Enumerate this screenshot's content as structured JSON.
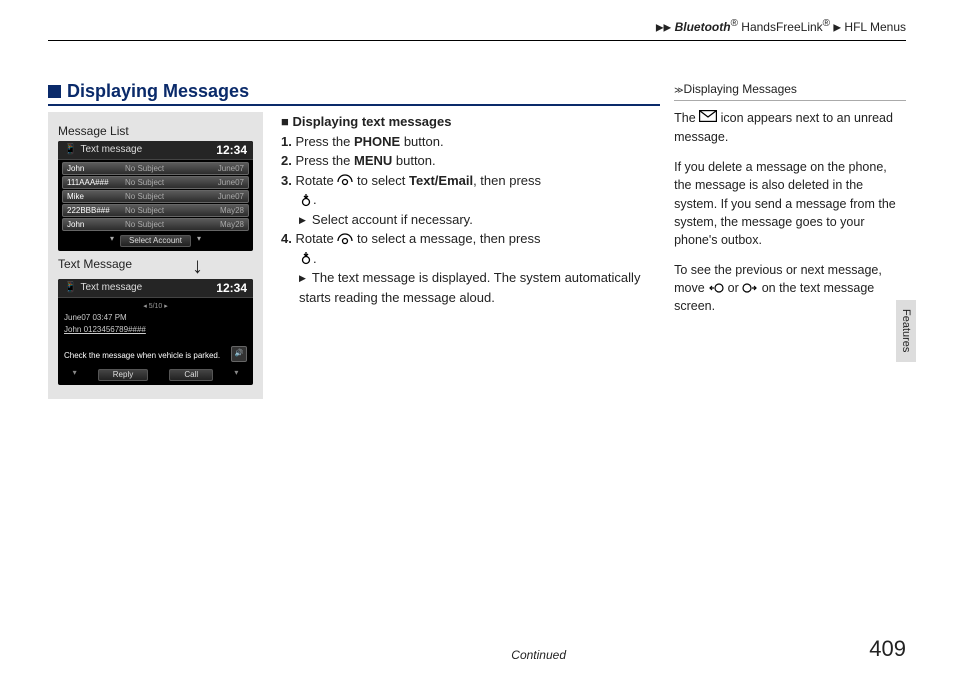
{
  "breadcrumb": {
    "bt": "Bluetooth",
    "reg": "®",
    "hfl": " HandsFreeLink",
    "sep": "▶",
    "tail": "HFL Menus"
  },
  "section": {
    "title": "Displaying Messages"
  },
  "figure": {
    "label1": "Message List",
    "label2": "Text Message",
    "arrow": "↓",
    "ss1": {
      "title": "Text message",
      "clock": "12:34",
      "rows": [
        {
          "sender": "John",
          "subj": "No Subject",
          "date": "June07"
        },
        {
          "sender": "111AAA###",
          "subj": "No Subject",
          "date": "June07"
        },
        {
          "sender": "Mike",
          "subj": "No Subject",
          "date": "June07"
        },
        {
          "sender": "222BBB###",
          "subj": "No Subject",
          "date": "May28"
        },
        {
          "sender": "John",
          "subj": "No Subject",
          "date": "May28"
        }
      ],
      "footer": "Select Account"
    },
    "ss2": {
      "title": "Text message",
      "clock": "12:34",
      "counter": "5/10",
      "meta1": "June07 03:47 PM",
      "meta2": "John 0123456789####",
      "body": "Check the message when vehicle is parked.",
      "btn1": "Reply",
      "btn2": "Call"
    }
  },
  "instr": {
    "heading": "Displaying text messages",
    "s1a": "1.",
    "s1b": " Press the ",
    "s1c": "PHONE",
    "s1d": " button.",
    "s2a": "2.",
    "s2b": " Press the ",
    "s2c": "MENU",
    "s2d": " button.",
    "s3a": "3.",
    "s3b": " Rotate ",
    "s3c": " to select ",
    "s3d": "Text/Email",
    "s3e": ", then press",
    "s3f": ".",
    "s3g": "Select account if necessary.",
    "s4a": "4.",
    "s4b": " Rotate ",
    "s4c": " to select a message, then press",
    "s4d": ".",
    "s4e": "The text message is displayed. The system automatically starts reading the message aloud."
  },
  "right": {
    "title": "Displaying Messages",
    "p1a": "The ",
    "p1b": " icon appears next to an unread message.",
    "p2": "If you delete a message on the phone, the message is also deleted in the system. If you send a message from the system, the message goes to your phone's outbox.",
    "p3a": "To see the previous or next message, move ",
    "p3b": " or ",
    "p3c": " on the text message screen."
  },
  "footer": {
    "continued": "Continued",
    "page": "409"
  },
  "sidetab": "Features"
}
